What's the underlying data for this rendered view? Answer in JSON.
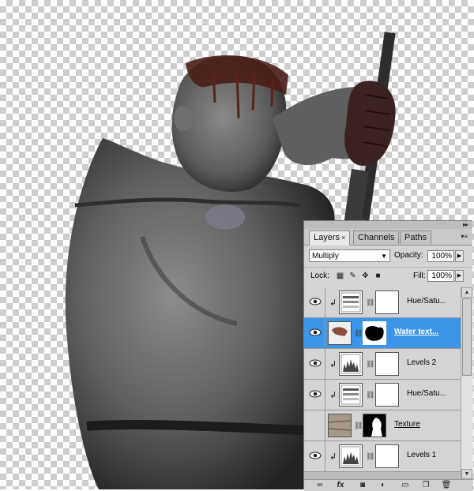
{
  "tabs": [
    {
      "label": "Layers",
      "close": "×",
      "active": true
    },
    {
      "label": "Channels",
      "active": false
    },
    {
      "label": "Paths",
      "active": false
    }
  ],
  "panel_menu": "▸▸",
  "blend_mode": "Multiply",
  "opacity_label": "Opacity:",
  "opacity_value": "100%",
  "lock_label": "Lock:",
  "fill_label": "Fill:",
  "fill_value": "100%",
  "layers": [
    {
      "name": "Hue/Satu...",
      "type": "adjustment-hue",
      "visible": true,
      "clipped": true,
      "selected": false
    },
    {
      "name": "Water text...",
      "type": "image-mask",
      "visible": true,
      "clipped": false,
      "selected": true
    },
    {
      "name": "Levels 2",
      "type": "adjustment-levels",
      "visible": true,
      "clipped": true,
      "selected": false
    },
    {
      "name": "Hue/Satu...",
      "type": "adjustment-hue",
      "visible": true,
      "clipped": true,
      "selected": false
    },
    {
      "name": "Texture",
      "type": "image-mask",
      "visible": false,
      "clipped": false,
      "selected": false
    },
    {
      "name": "Levels 1",
      "type": "adjustment-levels",
      "visible": true,
      "clipped": true,
      "selected": false
    }
  ],
  "bottom_icons": [
    "link-layers-icon",
    "fx-icon",
    "add-mask-icon",
    "new-adjustment-icon",
    "new-group-icon",
    "new-layer-icon",
    "delete-layer-icon"
  ],
  "colors": {
    "selection": "#3d95ea",
    "panel": "#d4d4d4"
  }
}
